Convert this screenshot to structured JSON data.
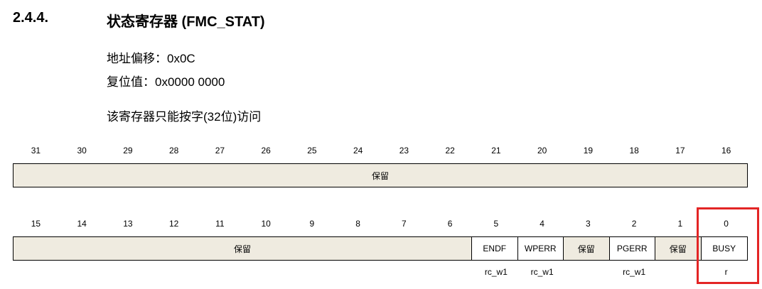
{
  "section": {
    "number": "2.4.4.",
    "title": "状态寄存器  (FMC_STAT)"
  },
  "info": {
    "address_offset": "地址偏移：0x0C",
    "reset_value": "复位值：0x0000 0000",
    "access_note": "该寄存器只能按字(32位)访问"
  },
  "upper": {
    "bits": [
      "31",
      "30",
      "29",
      "28",
      "27",
      "26",
      "25",
      "24",
      "23",
      "22",
      "21",
      "20",
      "19",
      "18",
      "17",
      "16"
    ],
    "fields": [
      {
        "label": "保留",
        "span": 16,
        "reserved": true
      }
    ]
  },
  "lower": {
    "bits": [
      "15",
      "14",
      "13",
      "12",
      "11",
      "10",
      "9",
      "8",
      "7",
      "6",
      "5",
      "4",
      "3",
      "2",
      "1",
      "0"
    ],
    "fields": [
      {
        "label": "保留",
        "span": 10,
        "reserved": true
      },
      {
        "label": "ENDF",
        "span": 1,
        "reserved": false
      },
      {
        "label": "WPERR",
        "span": 1,
        "reserved": false
      },
      {
        "label": "保留",
        "span": 1,
        "reserved": true
      },
      {
        "label": "PGERR",
        "span": 1,
        "reserved": false
      },
      {
        "label": "保留",
        "span": 1,
        "reserved": true
      },
      {
        "label": "BUSY",
        "span": 1,
        "reserved": false
      }
    ],
    "access": [
      "",
      "",
      "",
      "",
      "",
      "",
      "",
      "",
      "",
      "",
      "rc_w1",
      "rc_w1",
      "",
      "rc_w1",
      "",
      "r"
    ]
  },
  "highlight_color": "#e32525"
}
